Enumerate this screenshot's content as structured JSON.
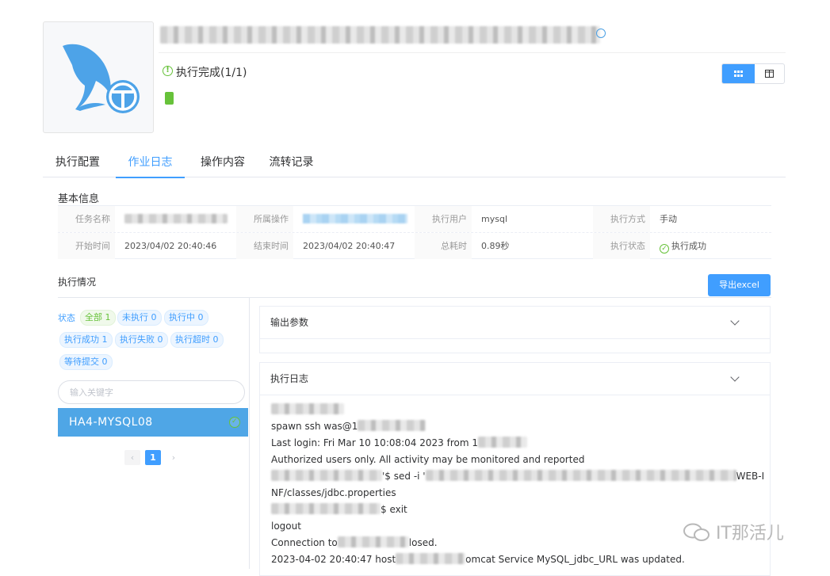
{
  "header": {
    "status_icon": "check-circle-icon",
    "status_text": "执行完成(1/1)",
    "status_color": "#67c23a",
    "view_toggle": {
      "active": "grid",
      "grid_icon": "grid-icon",
      "split_icon": "split-view-icon"
    }
  },
  "tabs": [
    "执行配置",
    "作业日志",
    "操作内容",
    "流转记录"
  ],
  "active_tab": "作业日志",
  "basic_info": {
    "title": "基本信息",
    "task_name_label": "任务名称",
    "operation_label": "所属操作",
    "user_label": "执行用户",
    "user_value": "mysql",
    "method_label": "执行方式",
    "method_value": "手动",
    "start_label": "开始时间",
    "start_value": "2023/04/02 20:40:46",
    "end_label": "结束时间",
    "end_value": "2023/04/02 20:40:47",
    "duration_label": "总耗时",
    "duration_value": "0.89秒",
    "state_label": "执行状态",
    "state_value": "执行成功"
  },
  "execution": {
    "title": "执行情况",
    "export_button": "导出excel",
    "state_filter_label": "状态",
    "chips": [
      "全部 1",
      "未执行 0",
      "执行中 0",
      "执行成功 1",
      "执行失败 0",
      "执行超时 0",
      "等待提交 0"
    ],
    "search_placeholder": "输入关键字",
    "host": "HA4-MYSQL08",
    "page_current": "1"
  },
  "panels": {
    "output_title": "输出参数",
    "log_title": "执行日志",
    "log_lines": [
      "spawn ssh was@1",
      "Last login: Fri Mar 10 10:08:04 2023 from 1",
      "Authorized users only. All activity may be monitored and reported",
      "'$ sed -i '",
      "WEB-I",
      "NF/classes/jdbc.properties",
      "$ exit",
      "logout",
      "Connection to",
      "losed.",
      "2023-04-02 20:40:47 host",
      "omcat Service MySQL_jdbc_URL was updated."
    ]
  },
  "watermark": "IT那活儿",
  "colors": {
    "primary": "#409eff",
    "success": "#67c23a",
    "host_bg": "#4fa6e6"
  }
}
